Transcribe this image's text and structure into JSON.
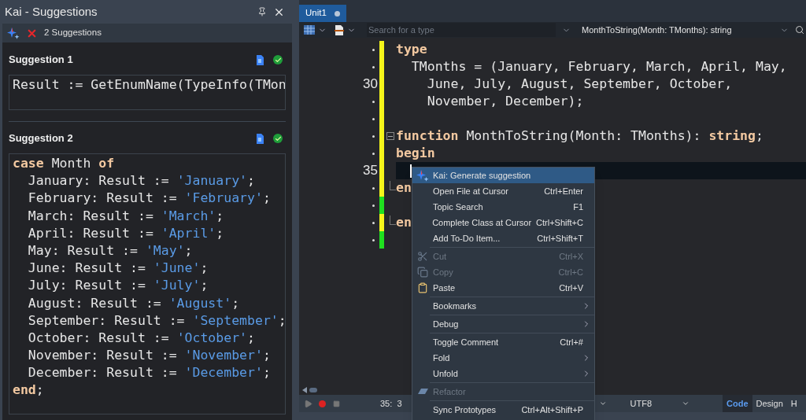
{
  "panel": {
    "title": "Kai - Suggestions",
    "count": "2 Suggestions",
    "suggestions": [
      {
        "title": "Suggestion 1",
        "lines": [
          [
            {
              "text": "Result := GetEnumName(TypeInfo(TMon",
              "kind": "plain"
            }
          ]
        ]
      },
      {
        "title": "Suggestion 2",
        "lines": [
          [
            {
              "text": "case",
              "kind": "keyword"
            },
            {
              "text": " Month ",
              "kind": "plain"
            },
            {
              "text": "of",
              "kind": "keyword"
            }
          ],
          [
            {
              "text": "  January: Result := ",
              "kind": "plain"
            },
            {
              "text": "'January'",
              "kind": "string"
            },
            {
              "text": ";",
              "kind": "plain"
            }
          ],
          [
            {
              "text": "  February: Result := ",
              "kind": "plain"
            },
            {
              "text": "'February'",
              "kind": "string"
            },
            {
              "text": ";",
              "kind": "plain"
            }
          ],
          [
            {
              "text": "  March: Result := ",
              "kind": "plain"
            },
            {
              "text": "'March'",
              "kind": "string"
            },
            {
              "text": ";",
              "kind": "plain"
            }
          ],
          [
            {
              "text": "  April: Result := ",
              "kind": "plain"
            },
            {
              "text": "'April'",
              "kind": "string"
            },
            {
              "text": ";",
              "kind": "plain"
            }
          ],
          [
            {
              "text": "  May: Result := ",
              "kind": "plain"
            },
            {
              "text": "'May'",
              "kind": "string"
            },
            {
              "text": ";",
              "kind": "plain"
            }
          ],
          [
            {
              "text": "  June: Result := ",
              "kind": "plain"
            },
            {
              "text": "'June'",
              "kind": "string"
            },
            {
              "text": ";",
              "kind": "plain"
            }
          ],
          [
            {
              "text": "  July: Result := ",
              "kind": "plain"
            },
            {
              "text": "'July'",
              "kind": "string"
            },
            {
              "text": ";",
              "kind": "plain"
            }
          ],
          [
            {
              "text": "  August: Result := ",
              "kind": "plain"
            },
            {
              "text": "'August'",
              "kind": "string"
            },
            {
              "text": ";",
              "kind": "plain"
            }
          ],
          [
            {
              "text": "  September: Result := ",
              "kind": "plain"
            },
            {
              "text": "'September'",
              "kind": "string"
            },
            {
              "text": ";",
              "kind": "plain"
            }
          ],
          [
            {
              "text": "  October: Result := ",
              "kind": "plain"
            },
            {
              "text": "'October'",
              "kind": "string"
            },
            {
              "text": ";",
              "kind": "plain"
            }
          ],
          [
            {
              "text": "  November: Result := ",
              "kind": "plain"
            },
            {
              "text": "'November'",
              "kind": "string"
            },
            {
              "text": ";",
              "kind": "plain"
            }
          ],
          [
            {
              "text": "  December: Result := ",
              "kind": "plain"
            },
            {
              "text": "'December'",
              "kind": "string"
            },
            {
              "text": ";",
              "kind": "plain"
            }
          ],
          [
            {
              "text": "end",
              "kind": "keyword"
            },
            {
              "text": ";",
              "kind": "plain"
            }
          ]
        ]
      }
    ]
  },
  "editor": {
    "tabs": [
      {
        "label": "Unit1",
        "selected": true,
        "modified": true
      }
    ],
    "search": {
      "placeholder": "Search for a type"
    },
    "method": "MonthToString(Month: TMonths): string",
    "lines": [
      {
        "color": "#f5f51a",
        "current": false,
        "tokens": [
          {
            "text": "type",
            "kind": "keyword"
          }
        ]
      },
      {
        "color": "#f5f51a",
        "current": false,
        "tokens": [
          {
            "text": "  TMonths = (January, February, March, April, May,",
            "kind": "plain"
          }
        ]
      },
      {
        "number": "30",
        "color": "#f5f51a",
        "current": false,
        "tokens": [
          {
            "text": "    June, July, August, September, October,",
            "kind": "plain"
          }
        ]
      },
      {
        "color": "#f5f51a",
        "current": false,
        "tokens": [
          {
            "text": "    November, December);",
            "kind": "plain"
          }
        ]
      },
      {
        "color": "#f5f51a",
        "current": false
      },
      {
        "color": "#f5f51a",
        "current": false,
        "fold_start": true,
        "tokens": [
          {
            "text": "function",
            "kind": "keyword"
          },
          {
            "text": " MonthToString(Month: TMonths): ",
            "kind": "plain"
          },
          {
            "text": "string",
            "kind": "keyword"
          },
          {
            "text": ";",
            "kind": "plain"
          }
        ]
      },
      {
        "color": "#f5f51a",
        "current": false,
        "tokens": [
          {
            "text": "begin",
            "kind": "keyword"
          }
        ]
      },
      {
        "number": "35",
        "color": "#f5f51a",
        "current": true
      },
      {
        "color": "#f5f51a",
        "current": false,
        "fold_end": true,
        "tokens": [
          {
            "text": "en",
            "kind": "keyword"
          }
        ]
      },
      {
        "color": "#1fe01f",
        "current": false
      },
      {
        "color": "#f5f51a",
        "current": false,
        "fold_end": true,
        "tokens": [
          {
            "text": "en",
            "kind": "keyword"
          }
        ]
      },
      {
        "color": "#1fe01f",
        "current": false
      }
    ],
    "status": {
      "position": "35:  3",
      "encoding": "UTF8",
      "views": [
        {
          "label": "Code",
          "selected": true
        },
        {
          "label": "Design",
          "selected": false
        },
        {
          "label": "H",
          "selected": false
        }
      ]
    }
  },
  "menu": {
    "items": [
      {
        "kind": "ai",
        "label": "Kai: Generate suggestion",
        "selected": true,
        "disabled": false,
        "submenu": false
      },
      {
        "kind": "plain",
        "label": "Open File at Cursor",
        "shortcut": "Ctrl+Enter",
        "selected": false,
        "disabled": false,
        "submenu": false
      },
      {
        "kind": "plain",
        "label": "Topic Search",
        "shortcut": "F1",
        "selected": false,
        "disabled": false,
        "submenu": false
      },
      {
        "kind": "plain",
        "label": "Complete Class at Cursor",
        "shortcut": "Ctrl+Shift+C",
        "selected": false,
        "disabled": false,
        "submenu": false
      },
      {
        "kind": "plain",
        "label": "Add To-Do Item...",
        "shortcut": "Ctrl+Shift+T",
        "selected": false,
        "disabled": false,
        "submenu": false
      },
      {
        "kind": "separator"
      },
      {
        "kind": "cut",
        "label": "Cut",
        "shortcut": "Ctrl+X",
        "selected": false,
        "disabled": true,
        "submenu": false
      },
      {
        "kind": "copy",
        "label": "Copy",
        "shortcut": "Ctrl+C",
        "selected": false,
        "disabled": true,
        "submenu": false
      },
      {
        "kind": "paste",
        "label": "Paste",
        "shortcut": "Ctrl+V",
        "selected": false,
        "disabled": false,
        "submenu": false
      },
      {
        "kind": "separator"
      },
      {
        "kind": "plain",
        "label": "Bookmarks",
        "selected": false,
        "disabled": false,
        "submenu": true
      },
      {
        "kind": "separator"
      },
      {
        "kind": "plain",
        "label": "Debug",
        "selected": false,
        "disabled": false,
        "submenu": true
      },
      {
        "kind": "separator"
      },
      {
        "kind": "plain",
        "label": "Toggle Comment",
        "shortcut": "Ctrl+#",
        "selected": false,
        "disabled": false,
        "submenu": false
      },
      {
        "kind": "plain",
        "label": "Fold",
        "selected": false,
        "disabled": false,
        "submenu": true
      },
      {
        "kind": "plain",
        "label": "Unfold",
        "selected": false,
        "disabled": false,
        "submenu": true
      },
      {
        "kind": "separator"
      },
      {
        "kind": "refactor",
        "label": "Refactor",
        "selected": false,
        "disabled": true,
        "submenu": false
      },
      {
        "kind": "separator"
      },
      {
        "kind": "plain",
        "label": "Sync Prototypes",
        "shortcut": "Ctrl+Alt+Shift+P",
        "selected": false,
        "disabled": false,
        "submenu": false
      }
    ]
  }
}
